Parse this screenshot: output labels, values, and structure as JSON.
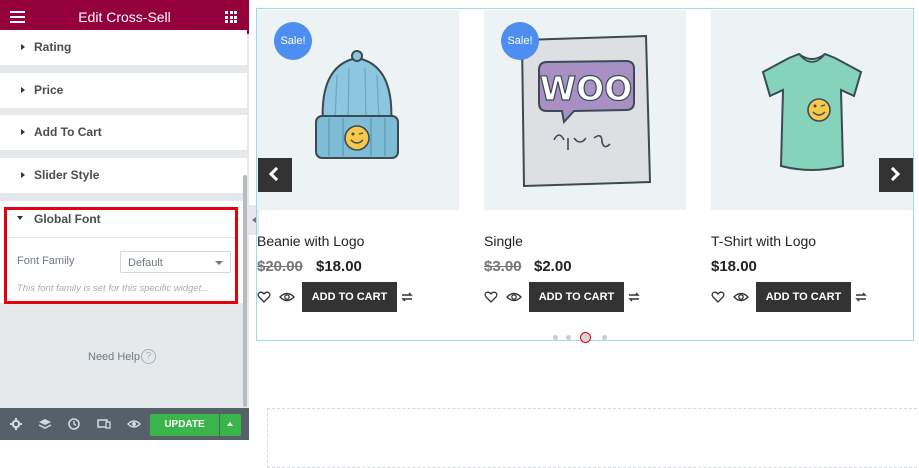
{
  "editor": {
    "title": "Edit Cross-Sell",
    "sections": [
      "Rating",
      "Price",
      "Add To Cart",
      "Slider Style"
    ],
    "global_font": {
      "label": "Global Font",
      "font_family_label": "Font Family",
      "font_family_value": "Default",
      "description": "This font family is set for this specific widget..."
    },
    "need_help": "Need Help",
    "help_icon_glyph": "?",
    "footer": {
      "icons": [
        "settings-icon",
        "layers-icon",
        "history-icon",
        "responsive-icon",
        "preview-eye-icon"
      ],
      "update_label": "UPDATE"
    },
    "accent_color": "#93003c",
    "highlight_color": "#e3000f",
    "update_color": "#39b54a"
  },
  "preview": {
    "products": [
      {
        "name": "Beanie with Logo",
        "sale_badge": "Sale!",
        "old_price": "$20.00",
        "price": "$18.00",
        "cart_label": "ADD TO CART",
        "image": "beanie-image"
      },
      {
        "name": "Single",
        "sale_badge": "Sale!",
        "old_price": "$3.00",
        "price": "$2.00",
        "cart_label": "ADD TO CART",
        "image": "woo-single-image"
      },
      {
        "name": "T-Shirt with Logo",
        "sale_badge": "",
        "old_price": "",
        "price": "$18.00",
        "cart_label": "ADD TO CART",
        "image": "tshirt-image"
      }
    ],
    "pagination": {
      "dot_count": 4,
      "active_index": 2
    },
    "sale_badge_color": "#4d8ef0"
  }
}
